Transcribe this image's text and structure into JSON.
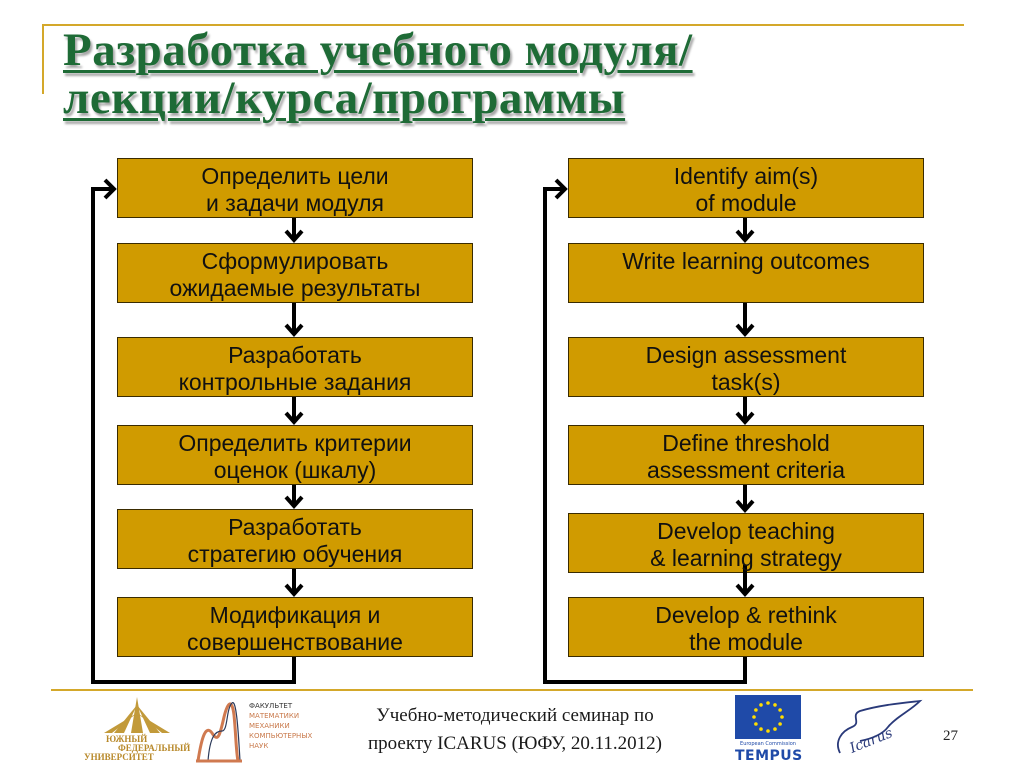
{
  "slide": {
    "title_lines": [
      "Разработка учебного модуля/",
      "лекции/курса/программы"
    ],
    "page_number": "27",
    "accent_color": "#d4a82a",
    "title_color": "#1e6b36",
    "box_color": "#d09b00"
  },
  "flow_ru": {
    "steps": [
      {
        "lines": [
          "Определить цели",
          "и задачи модуля"
        ]
      },
      {
        "lines": [
          "Сформулировать",
          "ожидаемые результаты"
        ]
      },
      {
        "lines": [
          "Разработать",
          "контрольные задания"
        ]
      },
      {
        "lines": [
          "Определить критерии",
          "оценок (шкалу)"
        ]
      },
      {
        "lines": [
          "Разработать",
          "стратегию обучения"
        ]
      },
      {
        "lines": [
          "Модификация и",
          "совершенствование"
        ]
      }
    ]
  },
  "flow_en": {
    "steps": [
      {
        "lines": [
          "Identify aim(s)",
          "of module"
        ]
      },
      {
        "lines": [
          "Write learning outcomes",
          ""
        ]
      },
      {
        "lines": [
          "Design assessment",
          "task(s)"
        ]
      },
      {
        "lines": [
          "Define threshold",
          "assessment criteria"
        ]
      },
      {
        "lines": [
          "Develop teaching",
          "& learning strategy"
        ]
      },
      {
        "lines": [
          "Develop & rethink",
          "the module"
        ]
      }
    ]
  },
  "footer": {
    "seminar_lines": [
      "Учебно-методический семинар по",
      "проекту ICARUS (ЮФУ, 20.11.2012)"
    ],
    "logos": {
      "sfedu": [
        "ЮЖНЫЙ",
        "ФЕДЕРАЛЬНЫЙ",
        "УНИВЕРСИТЕТ"
      ],
      "mmcs": [
        "ФАКУЛЬТЕТ",
        "МАТЕМАТИКИ",
        "МЕХАНИКИ",
        "КОМПЬЮТЕРНЫХ",
        "НАУК"
      ],
      "tempus_sub": "European Commission",
      "tempus_word": "TEMPUS",
      "icarus": "Icarus"
    }
  }
}
